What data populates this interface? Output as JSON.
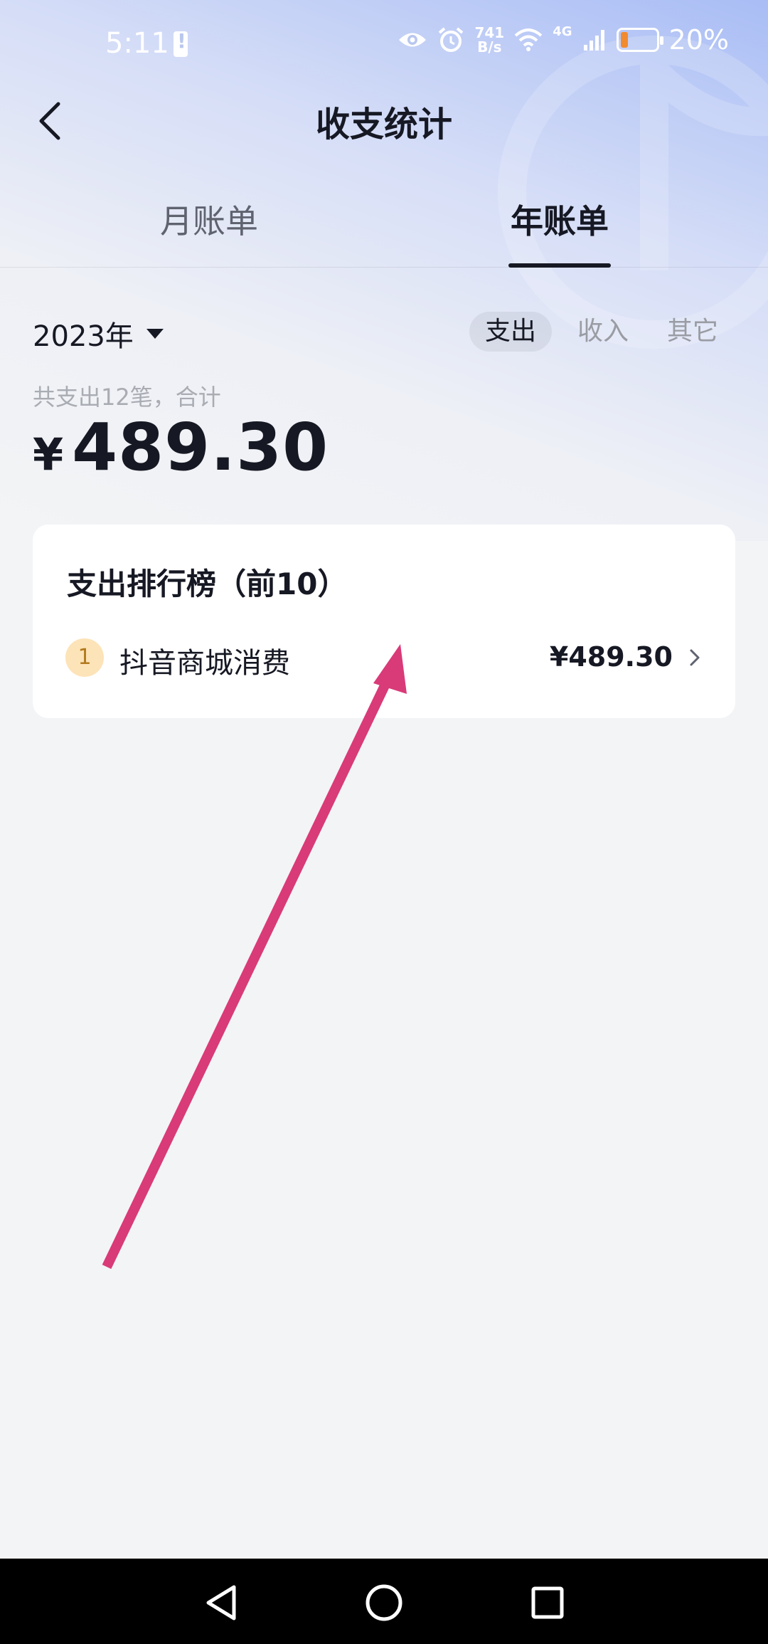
{
  "status_bar": {
    "time": "5:11",
    "speed_top": "741",
    "speed_bottom": "B/s",
    "network": "4G",
    "battery_percent": "20%",
    "battery_level": 0.2,
    "icons": [
      "alert-icon",
      "eye-icon",
      "alarm-icon",
      "wifi-icon",
      "signal-icon",
      "battery-icon"
    ]
  },
  "header": {
    "title": "收支统计",
    "back_icon": "chevron-left-icon"
  },
  "tabs": [
    {
      "label": "月账单",
      "active": false
    },
    {
      "label": "年账单",
      "active": true
    }
  ],
  "filters": {
    "year": "2023年",
    "options": [
      {
        "label": "支出",
        "active": true
      },
      {
        "label": "收入",
        "active": false
      },
      {
        "label": "其它",
        "active": false
      }
    ]
  },
  "summary": {
    "subtitle": "共支出12笔，合计",
    "currency": "¥",
    "amount": "489.30"
  },
  "ranking": {
    "title": "支出排行榜（前10）",
    "items": [
      {
        "rank": "1",
        "name": "抖音商城消费",
        "amount": "¥489.30"
      }
    ]
  },
  "colors": {
    "annotation_arrow": "#d93a78",
    "rank_badge_bg": "#fde3b8",
    "rank_badge_text": "#b27a1d",
    "battery_fill": "#f28a2e"
  },
  "nav_bar": {
    "icons": [
      "nav-back-icon",
      "nav-home-icon",
      "nav-recent-icon"
    ]
  }
}
